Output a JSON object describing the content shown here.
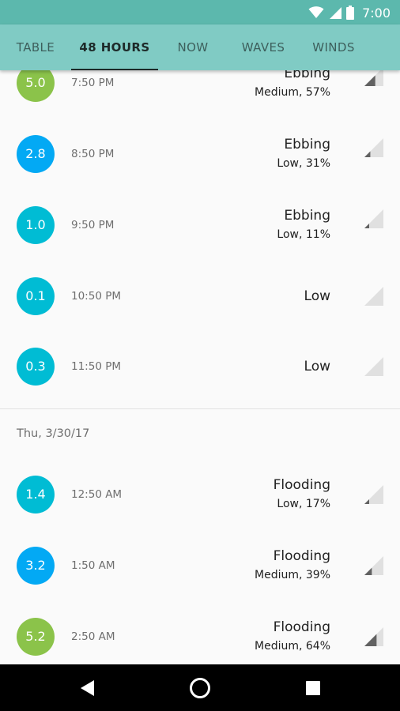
{
  "status_bar": {
    "time": "7:00",
    "icons": [
      "wifi-icon",
      "cellular-signal-icon",
      "battery-icon"
    ]
  },
  "tabs": [
    {
      "label": "TABLE",
      "active": false
    },
    {
      "label": "48 HOURS",
      "active": true
    },
    {
      "label": "NOW",
      "active": false
    },
    {
      "label": "WAVES",
      "active": false
    },
    {
      "label": "WINDS",
      "active": false
    }
  ],
  "colors": {
    "status_bar": "#5cb8ad",
    "tab_bar": "#80cbc4",
    "badge_green": "#8bc34a",
    "badge_blue": "#03a9f4",
    "badge_cyan": "#00bcd4"
  },
  "entries_day1": [
    {
      "height": "5.0",
      "time": "7:50 PM",
      "state": "Ebbing",
      "detail": "Medium, 57%",
      "color": "#8bc34a",
      "level": 0.57
    },
    {
      "height": "2.8",
      "time": "8:50 PM",
      "state": "Ebbing",
      "detail": "Low, 31%",
      "color": "#03a9f4",
      "level": 0.31
    },
    {
      "height": "1.0",
      "time": "9:50 PM",
      "state": "Ebbing",
      "detail": "Low, 11%",
      "color": "#00bcd4",
      "level": 0.11
    },
    {
      "height": "0.1",
      "time": "10:50 PM",
      "state": "Low",
      "detail": "",
      "color": "#00bcd4",
      "level": 0.0
    },
    {
      "height": "0.3",
      "time": "11:50 PM",
      "state": "Low",
      "detail": "",
      "color": "#00bcd4",
      "level": 0.0
    }
  ],
  "date_header": "Thu, 3/30/17",
  "entries_day2": [
    {
      "height": "1.4",
      "time": "12:50 AM",
      "state": "Flooding",
      "detail": "Low, 17%",
      "color": "#00bcd4",
      "level": 0.17
    },
    {
      "height": "3.2",
      "time": "1:50 AM",
      "state": "Flooding",
      "detail": "Medium, 39%",
      "color": "#03a9f4",
      "level": 0.39
    },
    {
      "height": "5.2",
      "time": "2:50 AM",
      "state": "Flooding",
      "detail": "Medium, 64%",
      "color": "#8bc34a",
      "level": 0.64
    }
  ],
  "nav": {
    "back": "back-icon",
    "home": "home-icon",
    "recents": "recents-icon"
  }
}
